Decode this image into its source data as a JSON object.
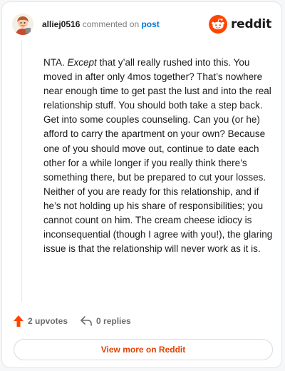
{
  "comment": {
    "username": "alliej0516",
    "commented_text": "commented on",
    "post_link": "post",
    "brand": "reddit",
    "body_intro": "NTA. ",
    "body_emphasis": "Except",
    "body_rest": " that y’all really rushed into this. You moved in after only 4mos together? That’s nowhere near enough time to get past the lust and into the real relationship stuff. You should both take a step back. Get into some couples counseling. Can you (or he) afford to carry the apartment on your own? Because one of you should move out, continue to date each other for a while longer if you really think there’s something there, but be prepared to cut your losses. Neither of you are ready for this relationship, and if he’s not holding up his share of responsibilities; you cannot count on him. The cream cheese idiocy is inconsequential (though I agree with you!), the glaring issue is that the relationship will never work as it is.",
    "upvotes": "2 upvotes",
    "replies": "0 replies",
    "view_more": "View more on Reddit"
  },
  "icons": {
    "avatar": "avatar",
    "brand": "reddit-snoo-icon",
    "upvote": "upvote-arrow-icon",
    "reply": "reply-arrow-icon"
  },
  "colors": {
    "upvote": "#ff4500",
    "link": "#0079d3",
    "view_more": "#e34200",
    "brand": "#ff4500"
  }
}
